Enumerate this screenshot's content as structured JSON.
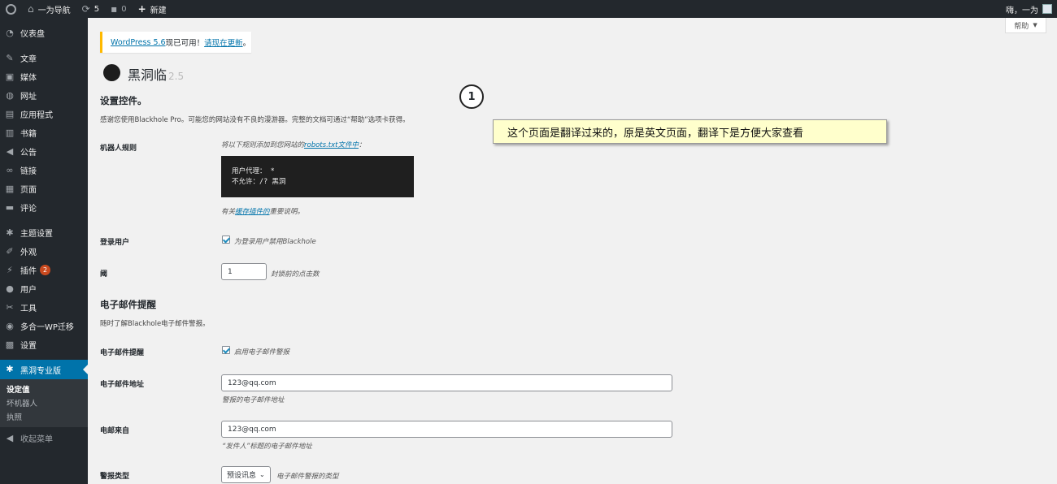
{
  "adminbar": {
    "site_name": "一为导航",
    "updates_count": "5",
    "comments_count": "0",
    "new_label": "新建",
    "greeting": "嗨，一为"
  },
  "sidebar": {
    "items": [
      {
        "label": "仪表盘",
        "icon": "dashboard-icon"
      },
      {
        "label": "文章",
        "icon": "pin-icon"
      },
      {
        "label": "媒体",
        "icon": "media-icon"
      },
      {
        "label": "网址",
        "icon": "globe-icon"
      },
      {
        "label": "应用程式",
        "icon": "app-icon"
      },
      {
        "label": "书籍",
        "icon": "book-icon"
      },
      {
        "label": "公告",
        "icon": "megaphone-icon"
      },
      {
        "label": "链接",
        "icon": "link-icon"
      },
      {
        "label": "页面",
        "icon": "page-icon"
      },
      {
        "label": "评论",
        "icon": "comment-icon"
      },
      {
        "label": "主题设置",
        "icon": "gear-icon"
      },
      {
        "label": "外观",
        "icon": "brush-icon"
      },
      {
        "label": "插件",
        "icon": "plugin-icon",
        "badge": "2"
      },
      {
        "label": "用户",
        "icon": "user-icon"
      },
      {
        "label": "工具",
        "icon": "wrench-icon"
      },
      {
        "label": "多合一WP迁移",
        "icon": "migrate-icon"
      },
      {
        "label": "设置",
        "icon": "settings-icon"
      },
      {
        "label": "黑洞专业版",
        "icon": "gear-icon"
      }
    ],
    "submenu": [
      "设定值",
      "坏机器人",
      "执照"
    ],
    "collapse_label": "收起菜单"
  },
  "help_label": "帮助",
  "notice": {
    "link1": "WordPress 5.6",
    "text": "现已可用！",
    "link2": "请现在更新",
    "end": "。"
  },
  "plugin": {
    "title": "黑洞临",
    "version": "2.5"
  },
  "settings": {
    "heading": "设置控件。",
    "desc": "感谢您使用Blackhole Pro。可能您的网站没有不良的漫游器。完整的文档可通过“帮助”选项卡获得。",
    "robots_label": "机器人规则",
    "robots_hint_pre": "将以下规则添加到您网站的",
    "robots_hint_link": "robots.txt文件中",
    "robots_hint_post": "：",
    "robots_line1": "用户代理： *",
    "robots_line2": "不允许：/? 黑洞",
    "cache_note_pre": "有关",
    "cache_note_link": "缓存插件的",
    "cache_note_post": "重要说明。",
    "logged_label": "登录用户",
    "logged_text": "为登录用户禁用Blackhole",
    "threshold_label": "阈",
    "threshold_value": "1",
    "threshold_text": "封锁前的点击数"
  },
  "email": {
    "heading": "电子邮件提醒",
    "desc": "随时了解Blackhole电子邮件警报。",
    "alerts_label": "电子邮件提醒",
    "alerts_text": "启用电子邮件警报",
    "address_label": "电子邮件地址",
    "address_value": "123@qq.com",
    "address_note": "警报的电子邮件地址",
    "from_label": "电邮来自",
    "from_value": "123@qq.com",
    "from_note": "“发件人”标题的电子邮件地址",
    "type_label": "警报类型",
    "type_value": "预设讯息",
    "type_note": "电子邮件警报的类型"
  },
  "annotation": {
    "number": "1",
    "note": "这个页面是翻译过来的，原是英文页面，翻译下是方便大家查看"
  }
}
